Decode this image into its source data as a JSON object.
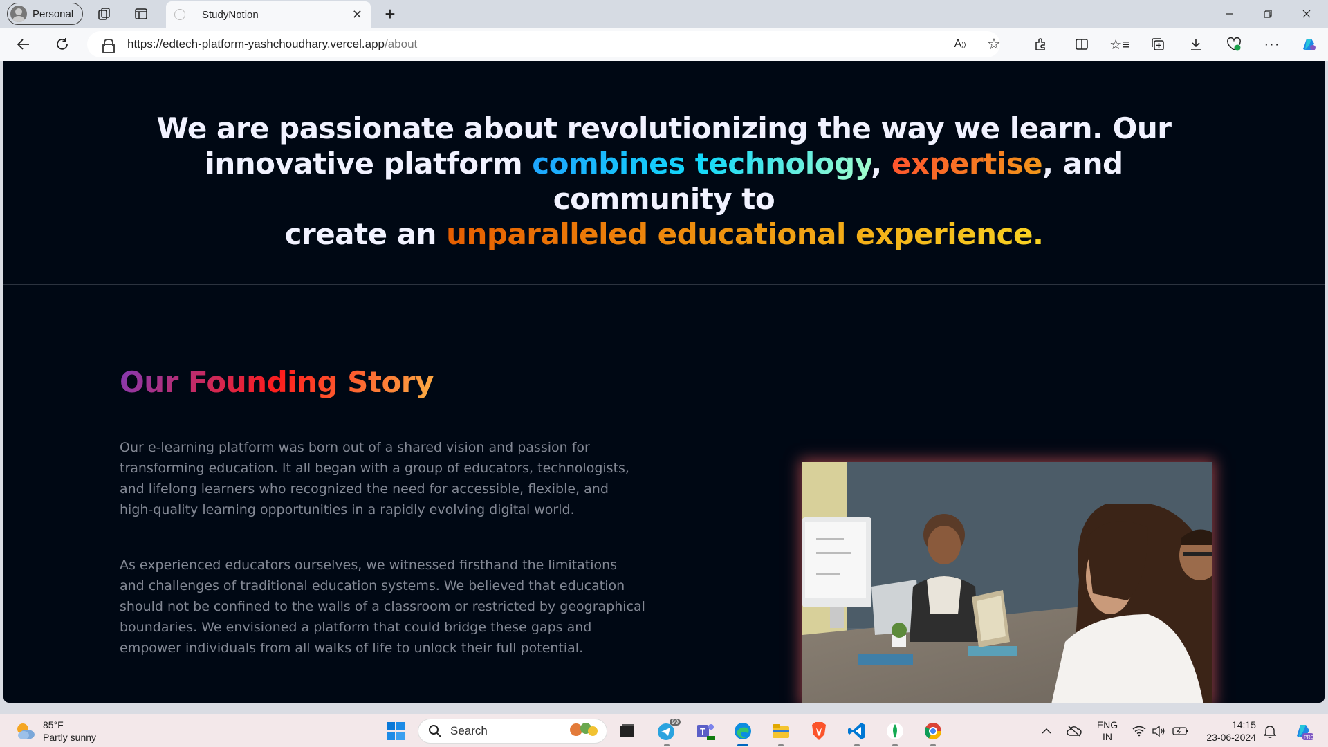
{
  "browser": {
    "profile_label": "Personal",
    "tab_title": "StudyNotion",
    "url_host": "https://edtech-platform-yashchoudhary.vercel.app",
    "url_path": "/about"
  },
  "hero": {
    "line1": "We are passionate about revolutionizing the way we learn. Our",
    "line2_pre": "innovative platform ",
    "highlight1": "combines technology",
    "sep1": ", ",
    "highlight2": "expertise",
    "line2_post": ", and community to",
    "line3_pre": "create an ",
    "highlight3": "unparalleled educational experience."
  },
  "story": {
    "title": "Our Founding Story",
    "paragraph1": "Our e-learning platform was born out of a shared vision and passion for transforming education. It all began with a group of educators, technologists, and lifelong learners who recognized the need for accessible, flexible, and high-quality learning opportunities in a rapidly evolving digital world.",
    "paragraph2": "As experienced educators ourselves, we witnessed firsthand the limitations and challenges of traditional education systems. We believed that education should not be confined to the walls of a classroom or restricted by geographical boundaries. We envisioned a platform that could bridge these gaps and empower individuals from all walks of life to unlock their full potential."
  },
  "taskbar": {
    "weather_temp": "85°F",
    "weather_desc": "Partly sunny",
    "search_placeholder": "Search",
    "telegram_badge": "99",
    "lang_top": "ENG",
    "lang_bottom": "IN",
    "time": "14:15",
    "date": "23-06-2024"
  },
  "colors": {
    "page_bg": "#000814",
    "hero_text": "#f1f2ff",
    "body_text": "#838894",
    "accent_blue": "#12d8fa",
    "accent_orange": "#ff512f",
    "accent_yellow": "#f09819"
  }
}
